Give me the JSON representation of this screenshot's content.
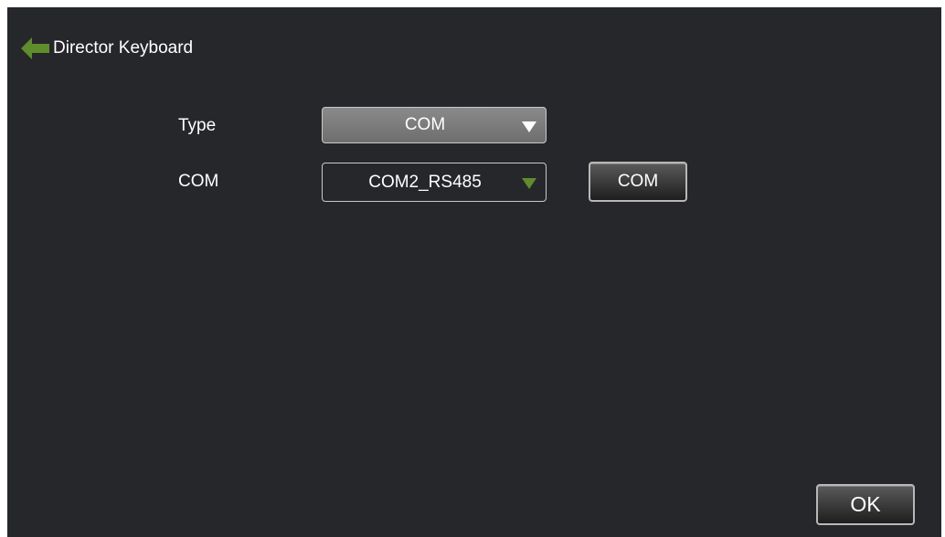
{
  "header": {
    "title": "Director Keyboard",
    "back_icon": "arrow-left-icon",
    "back_icon_color": "#5f8c2d"
  },
  "form": {
    "type": {
      "label": "Type",
      "value": "COM"
    },
    "com": {
      "label": "COM",
      "value": "COM2_RS485",
      "button_label": "COM"
    }
  },
  "footer": {
    "ok_label": "OK"
  },
  "colors": {
    "background": "#26272b",
    "accent": "#5f8c2d",
    "text": "#ffffff"
  }
}
